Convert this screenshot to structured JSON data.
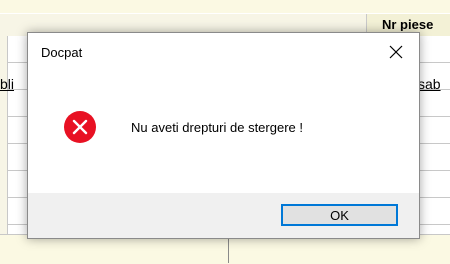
{
  "background": {
    "header_label": "Nr piese",
    "left_label": "bli",
    "right_label": "sab"
  },
  "dialog": {
    "title": "Docpat",
    "message": "Nu aveti drepturi de stergere !",
    "ok_label": "OK",
    "close_icon": "close-icon",
    "message_icon": "error-icon",
    "colors": {
      "error_red": "#e81123",
      "accent_focus": "#0078d7",
      "footer_bg": "#f0f0f0"
    }
  }
}
